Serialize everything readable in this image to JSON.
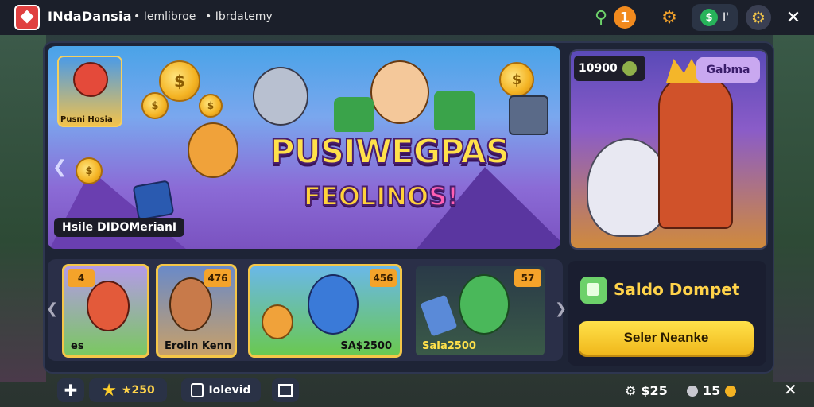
{
  "topbar": {
    "brand": "INdaDansia",
    "crumb1": "• Iemlibroe",
    "crumb2": "• Ibrdatemy",
    "balance_short": "I'",
    "close_icon": "close-icon"
  },
  "hero": {
    "title": "PUSIWEGPAS",
    "subtitle_a": "FEOLINO",
    "subtitle_b": "S!",
    "label": "Hsile DIDOMerianI",
    "char_card_label": "Pusni Hosia"
  },
  "promo": {
    "balance": "10900",
    "button": "Gabma"
  },
  "games": [
    {
      "badge": "4",
      "badge_pos": "left",
      "label_left": "es",
      "label_right": ""
    },
    {
      "badge": "476",
      "badge_pos": "right",
      "label_left": "Erolin Kenn",
      "label_right": ""
    },
    {
      "badge": "456",
      "badge_pos": "right",
      "label_left": "",
      "label_right": "SA$2500"
    },
    {
      "badge": "57",
      "badge_pos": "right",
      "label_left": "SaIa2500",
      "label_right": ""
    }
  ],
  "wallet": {
    "title": "Saldo Dompet",
    "button": "Seler Neanke"
  },
  "bottombar": {
    "stars": "★250",
    "button_label": "Iolevid",
    "stat1": "$25",
    "stat2": "15"
  },
  "colors": {
    "accent_gold": "#f4c648",
    "topbar": "#1b1f2a",
    "frame": "#1e2436"
  }
}
